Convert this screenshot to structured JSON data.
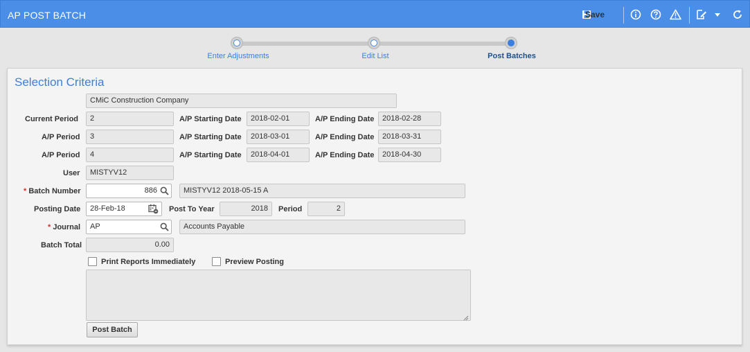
{
  "header": {
    "title": "AP POST BATCH",
    "save_label": "Save"
  },
  "wizard": {
    "steps": [
      {
        "label": "Enter Adjustments"
      },
      {
        "label": "Edit List"
      },
      {
        "label": "Post Batches"
      }
    ],
    "active_step": 3
  },
  "section": {
    "title": "Selection Criteria"
  },
  "form": {
    "company": "CMiC Construction Company",
    "current_period_label": "Current Period",
    "current_period": "2",
    "ap_period_label": "A/P Period",
    "ap_starting_date_label": "A/P Starting Date",
    "ap_ending_date_label": "A/P Ending Date",
    "periods": [
      {
        "period": "2",
        "start": "2018-02-01",
        "end": "2018-02-28"
      },
      {
        "period": "3",
        "start": "2018-03-01",
        "end": "2018-03-31"
      },
      {
        "period": "4",
        "start": "2018-04-01",
        "end": "2018-04-30"
      }
    ],
    "user_label": "User",
    "user": "MISTYV12",
    "required_marker": "*",
    "batch_number_label": "Batch Number",
    "batch_number": "886",
    "batch_description": "MISTYV12 2018-05-15 A",
    "posting_date_label": "Posting Date",
    "posting_date": "28-Feb-18",
    "post_to_year_label": "Post To Year",
    "post_to_year": "2018",
    "period_label": "Period",
    "period": "2",
    "journal_label": "Journal",
    "journal": "AP",
    "journal_description": "Accounts Payable",
    "batch_total_label": "Batch Total",
    "batch_total": "0.00",
    "print_reports_label": "Print Reports Immediately",
    "print_reports_checked": false,
    "preview_posting_label": "Preview Posting",
    "preview_posting_checked": false,
    "post_batch_label": "Post Batch"
  },
  "colors": {
    "header": "#4a8ee8",
    "accent": "#3a7fe0"
  },
  "icons": [
    "save-icon",
    "info-icon",
    "help-icon",
    "warning-icon",
    "edit-note-icon",
    "chevron-down-icon",
    "refresh-icon",
    "search-icon",
    "calendar-icon"
  ]
}
